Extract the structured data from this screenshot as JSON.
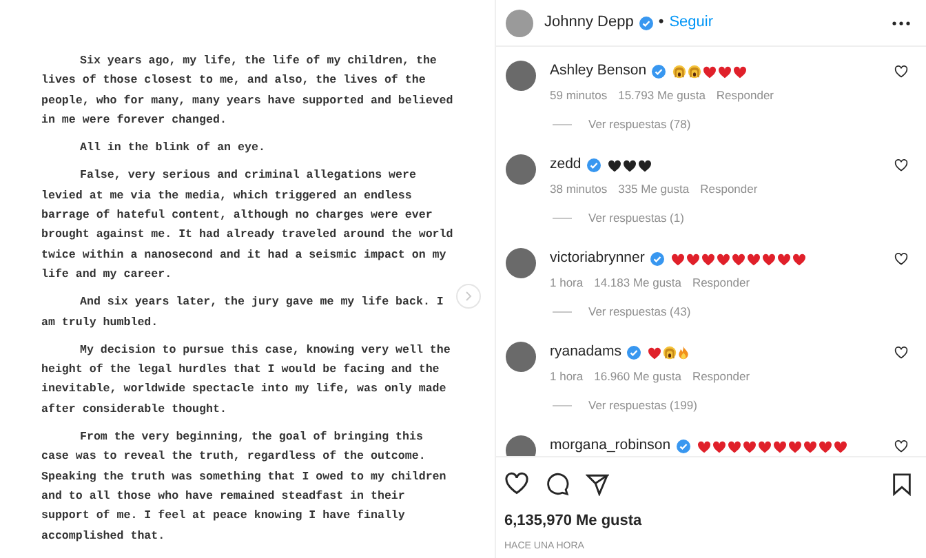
{
  "post_document": {
    "paragraphs": [
      "Six years ago, my life, the life of my children, the lives of those closest to me, and also, the lives of the people, who for many, many years have supported and believed in me were forever changed.",
      "All in the blink of an eye.",
      "False, very serious and criminal allegations were levied at me via the media, which triggered an endless barrage of hateful content, although no charges were ever brought against me. It had already traveled around the world twice within a nanosecond and it had a seismic impact on my life and my career.",
      "And six years later, the jury gave me my life back. I am truly humbled.",
      "My decision to pursue this case, knowing very well the height of the legal hurdles that I would be facing and the inevitable, worldwide spectacle into my life, was only made after considerable thought.",
      "From the very beginning, the goal of bringing this case was to reveal the truth, regardless of the outcome. Speaking the truth was something that I owed to my children and to all those who have remained steadfast in their support of me. I feel at peace knowing I have finally accomplished that."
    ]
  },
  "header": {
    "username": "Johnny Depp",
    "verified": true,
    "separator": "•",
    "follow": "Seguir"
  },
  "comments": [
    {
      "username": "Ashley Benson",
      "verified": true,
      "reactions": [
        {
          "kind": "scream"
        },
        {
          "kind": "scream"
        },
        {
          "kind": "heart"
        },
        {
          "kind": "heart"
        },
        {
          "kind": "heart"
        }
      ],
      "time": "59 minutos",
      "likes": "15.793 Me gusta",
      "reply": "Responder",
      "replies": "Ver respuestas (78)"
    },
    {
      "username": "zedd",
      "verified": true,
      "reactions": [
        {
          "kind": "black-heart"
        },
        {
          "kind": "black-heart"
        },
        {
          "kind": "black-heart"
        }
      ],
      "time": "38 minutos",
      "likes": "335 Me gusta",
      "reply": "Responder",
      "replies": "Ver respuestas (1)"
    },
    {
      "username": "victoriabrynner",
      "verified": true,
      "reactions": [
        {
          "kind": "heart"
        },
        {
          "kind": "heart"
        },
        {
          "kind": "heart"
        },
        {
          "kind": "heart"
        },
        {
          "kind": "heart"
        },
        {
          "kind": "heart"
        },
        {
          "kind": "heart"
        },
        {
          "kind": "heart"
        },
        {
          "kind": "heart"
        }
      ],
      "time": "1 hora",
      "likes": "14.183 Me gusta",
      "reply": "Responder",
      "replies": "Ver respuestas (43)"
    },
    {
      "username": "ryanadams",
      "verified": true,
      "reactions": [
        {
          "kind": "heart"
        },
        {
          "kind": "scream"
        },
        {
          "kind": "fire"
        }
      ],
      "time": "1 hora",
      "likes": "16.960 Me gusta",
      "reply": "Responder",
      "replies": "Ver respuestas (199)"
    },
    {
      "username": "morgana_robinson",
      "verified": true,
      "reactions": [
        {
          "kind": "heart"
        },
        {
          "kind": "heart"
        },
        {
          "kind": "heart"
        },
        {
          "kind": "heart"
        },
        {
          "kind": "heart"
        },
        {
          "kind": "heart"
        },
        {
          "kind": "heart"
        },
        {
          "kind": "heart"
        },
        {
          "kind": "heart"
        },
        {
          "kind": "heart"
        }
      ]
    }
  ],
  "likes": "6,135,970 Me gusta",
  "posted": "HACE UNA HORA"
}
